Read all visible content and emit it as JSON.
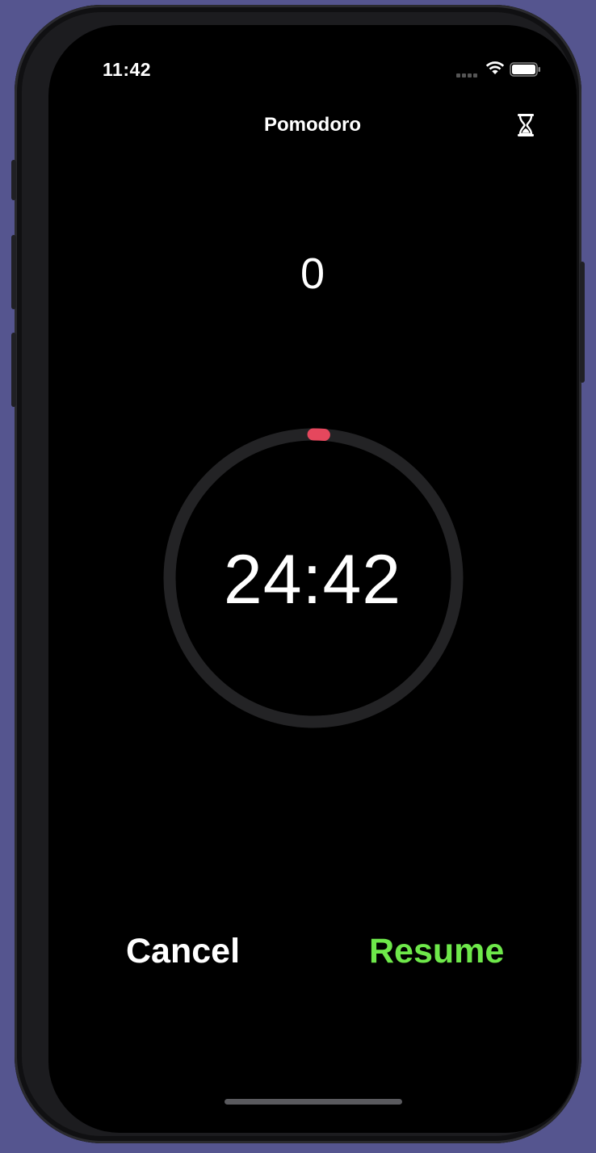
{
  "status_bar": {
    "time": "11:42",
    "signal_icon": "cellular-signal-icon",
    "wifi_icon": "wifi-icon",
    "battery_icon": "battery-icon"
  },
  "nav": {
    "title": "Pomodoro",
    "right_icon": "hourglass-icon"
  },
  "session_count": "0",
  "timer": {
    "remaining": "24:42",
    "progress_fraction": 0.012,
    "progress_color": "#e5475d",
    "track_color": "#232325"
  },
  "actions": {
    "cancel_label": "Cancel",
    "resume_label": "Resume",
    "resume_color": "#6ee84a"
  }
}
